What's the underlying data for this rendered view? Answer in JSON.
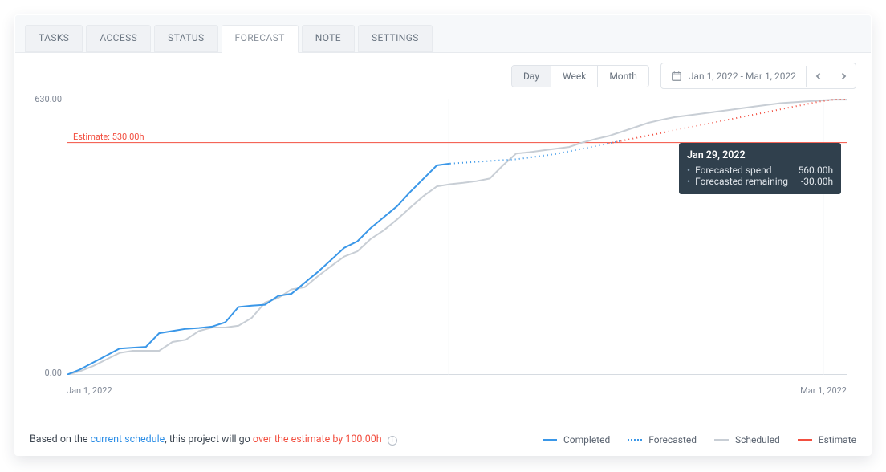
{
  "tabs": [
    "TASKS",
    "ACCESS",
    "STATUS",
    "FORECAST",
    "NOTE",
    "SETTINGS"
  ],
  "active_tab": 3,
  "toolbar": {
    "timescale": [
      "Day",
      "Week",
      "Month"
    ],
    "timescale_active": 0,
    "date_range": "Jan 1, 2022 - Mar 1, 2022"
  },
  "axis": {
    "ymax": "630.00",
    "ymin": "0.00",
    "xstart": "Jan 1, 2022",
    "xend": "Mar 1, 2022"
  },
  "estimate_label": "Estimate: 530.00h",
  "tooltip": {
    "date": "Jan 29, 2022",
    "rows": [
      {
        "label": "Forecasted spend",
        "value": "560.00h"
      },
      {
        "label": "Forecasted remaining",
        "value": "-30.00h"
      }
    ]
  },
  "legend": {
    "completed": "Completed",
    "forecasted": "Forecasted",
    "scheduled": "Scheduled",
    "estimate": "Estimate"
  },
  "summary": {
    "prefix": "Based on the ",
    "link": "current schedule",
    "mid": ", this project will go ",
    "over": "over the estimate by 100.00h"
  },
  "colors": {
    "completed": "#3a97e8",
    "scheduled": "#c8ced5",
    "forecasted": "#3a97e8",
    "estimate": "#f24f40",
    "forecasted_over": "#f24f40"
  },
  "chart_data": {
    "type": "line",
    "xlabel": "",
    "ylabel": "",
    "ylim": [
      0,
      630
    ],
    "estimate": 530,
    "x_start_label": "Jan 1, 2022",
    "x_end_label": "Mar 1, 2022",
    "n_days": 59,
    "series": [
      {
        "name": "Completed",
        "x_range": [
          0,
          29
        ],
        "values": [
          0,
          12,
          28,
          44,
          60,
          62,
          64,
          95,
          100,
          105,
          107,
          110,
          120,
          155,
          158,
          160,
          180,
          185,
          210,
          235,
          262,
          290,
          305,
          335,
          360,
          385,
          418,
          448,
          478,
          482
        ]
      },
      {
        "name": "Scheduled",
        "x_range": [
          0,
          59
        ],
        "values": [
          0,
          8,
          20,
          35,
          50,
          55,
          55,
          55,
          75,
          80,
          100,
          108,
          108,
          112,
          130,
          165,
          175,
          195,
          200,
          225,
          248,
          270,
          282,
          310,
          330,
          355,
          382,
          408,
          430,
          435,
          438,
          442,
          448,
          478,
          505,
          508,
          512,
          516,
          520,
          530,
          538,
          545,
          555,
          565,
          575,
          582,
          588,
          592,
          596,
          600,
          604,
          608,
          612,
          616,
          620,
          622,
          624,
          626,
          628,
          628
        ]
      },
      {
        "name": "Forecasted",
        "x_range": [
          29,
          59
        ],
        "values": [
          482,
          484,
          486,
          488,
          490,
          492,
          496,
          500,
          504,
          510,
          516,
          522,
          528,
          534,
          540,
          546,
          552,
          558,
          564,
          570,
          576,
          582,
          588,
          594,
          600,
          606,
          612,
          618,
          624,
          628,
          630
        ]
      }
    ]
  }
}
